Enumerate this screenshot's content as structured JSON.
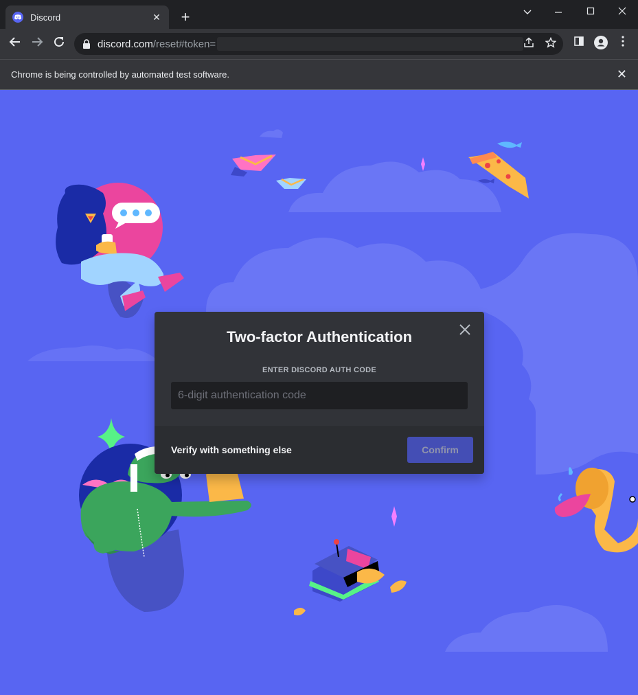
{
  "browser": {
    "tab_title": "Discord",
    "tab_close": "✕",
    "new_tab": "+",
    "url_host": "discord.com",
    "url_path": "/reset#token=",
    "infobar_text": "Chrome is being controlled by automated test software.",
    "infobar_close": "✕"
  },
  "modal": {
    "title": "Two-factor Authentication",
    "field_label": "ENTER DISCORD AUTH CODE",
    "input_placeholder": "6-digit authentication code",
    "verify_link": "Verify with something else",
    "confirm_label": "Confirm"
  },
  "colors": {
    "brand": "#5865f2",
    "modal_bg": "#313338",
    "footer_bg": "#2b2d31",
    "input_bg": "#1e1f22",
    "confirm_bg": "#4752c4"
  }
}
